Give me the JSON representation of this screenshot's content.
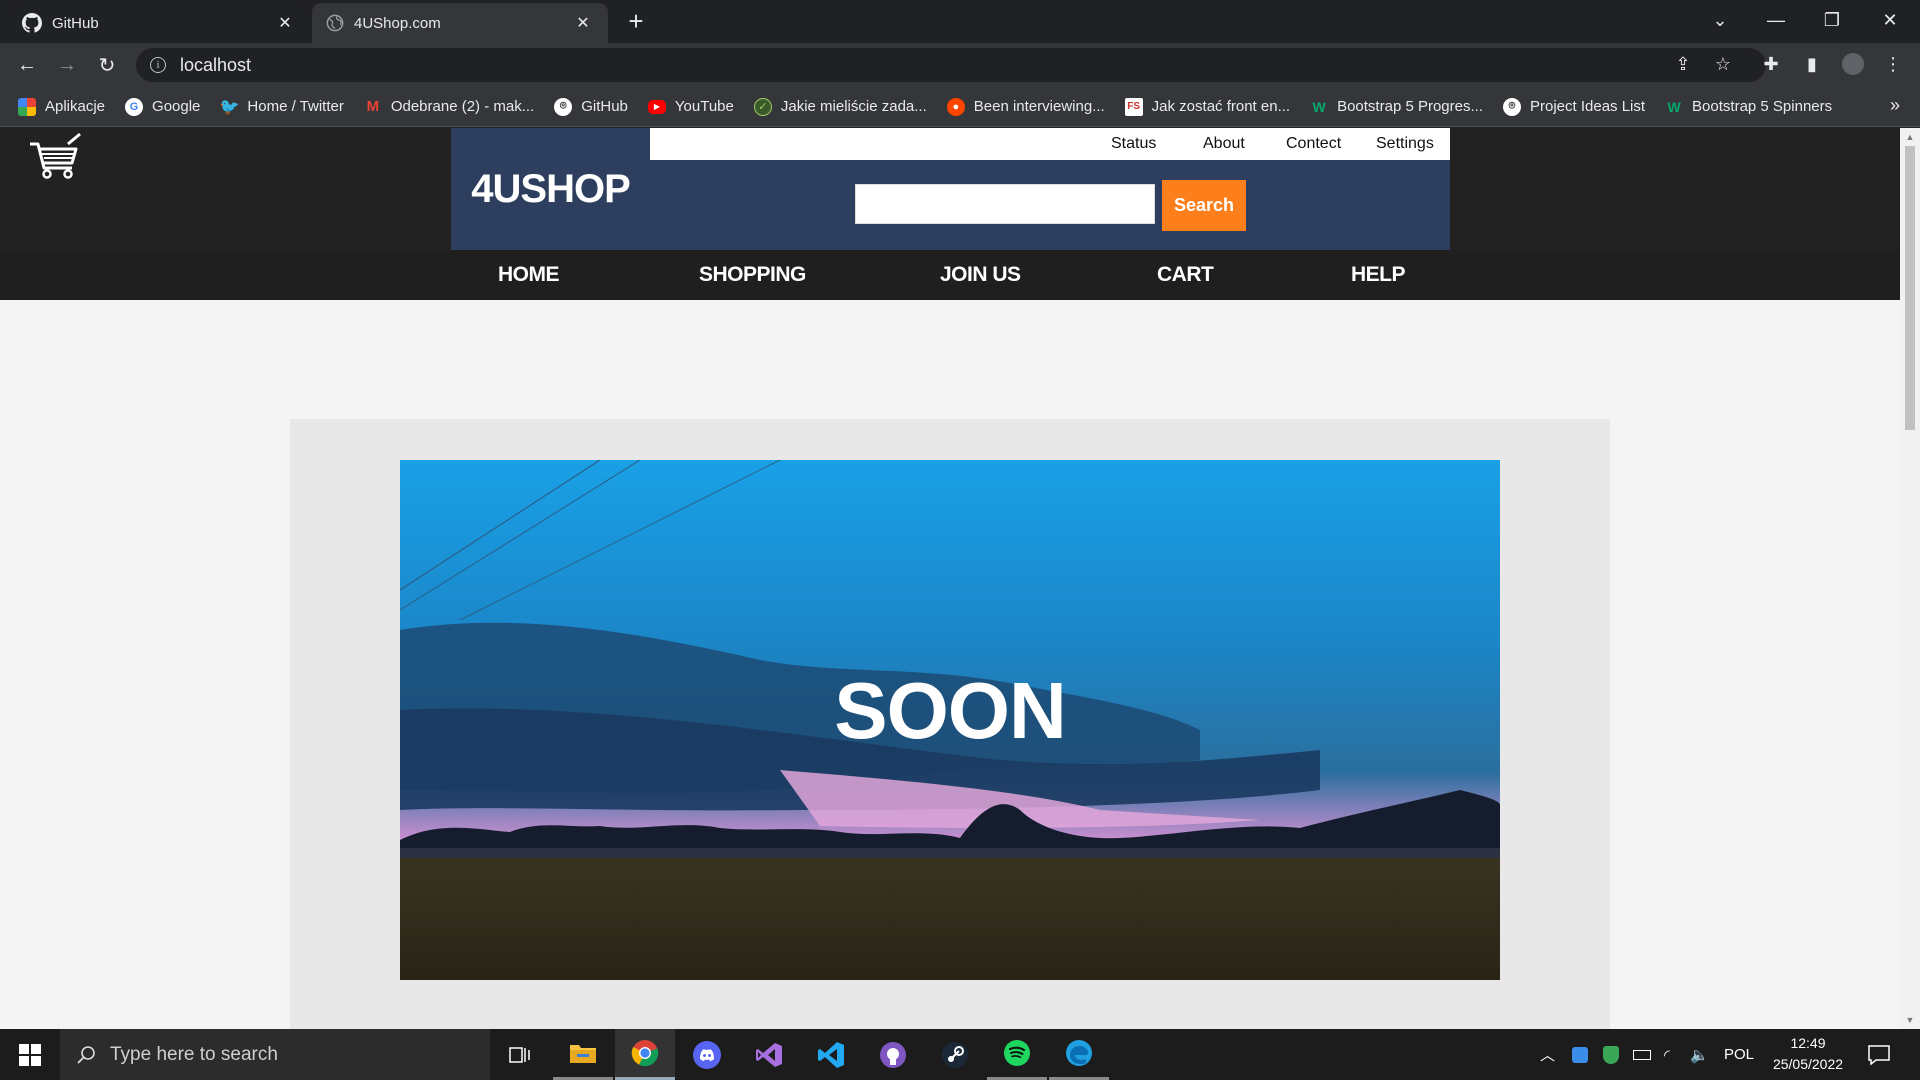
{
  "browser": {
    "tabs": [
      {
        "title": "GitHub",
        "icon": "github-icon",
        "active": false
      },
      {
        "title": "4UShop.com",
        "icon": "globe-icon",
        "active": true
      }
    ],
    "address": "localhost",
    "bookmarks": [
      {
        "label": "Aplikacje",
        "icon": "apps-grid-icon",
        "color": "#4285f4"
      },
      {
        "label": "Google",
        "icon": "google-icon",
        "color": "#ffffff"
      },
      {
        "label": "Home / Twitter",
        "icon": "twitter-icon",
        "color": "#1d9bf0"
      },
      {
        "label": "Odebrane (2) - mak...",
        "icon": "gmail-icon",
        "color": "#ea4335"
      },
      {
        "label": "GitHub",
        "icon": "github-icon",
        "color": "#ffffff"
      },
      {
        "label": "YouTube",
        "icon": "youtube-icon",
        "color": "#ff0000"
      },
      {
        "label": "Jakie mieliście zada...",
        "icon": "site-icon",
        "color": "#7cb342"
      },
      {
        "label": "Been interviewing...",
        "icon": "reddit-icon",
        "color": "#ff4500"
      },
      {
        "label": "Jak zostać front en...",
        "icon": "fs-icon",
        "color": "#ffffff"
      },
      {
        "label": "Bootstrap 5 Progres...",
        "icon": "w3-icon",
        "color": "#04aa6d"
      },
      {
        "label": "Project Ideas List",
        "icon": "github-icon",
        "color": "#ffffff"
      },
      {
        "label": "Bootstrap 5 Spinners",
        "icon": "w3-icon",
        "color": "#04aa6d"
      }
    ]
  },
  "site": {
    "brand": "4USHOP",
    "top_links": [
      "Status",
      "About",
      "Contect",
      "Settings"
    ],
    "search": {
      "value": "",
      "button_label": "Search"
    },
    "nav": [
      "HOME",
      "SHOPPING",
      "JOIN US",
      "CART",
      "HELP"
    ],
    "banner_text": "SOON",
    "colors": {
      "header": "#222222",
      "brand_bg": "#2d3e5e",
      "accent": "#fd7f1c"
    }
  },
  "taskbar": {
    "search_placeholder": "Type here to search",
    "apps": [
      "task-view-icon",
      "file-explorer-icon",
      "chrome-icon",
      "discord-icon",
      "visual-studio-icon",
      "vscode-icon",
      "github-desktop-icon",
      "steam-icon",
      "spotify-icon",
      "edge-icon"
    ],
    "language": "POL",
    "time": "12:49",
    "date": "25/05/2022"
  }
}
